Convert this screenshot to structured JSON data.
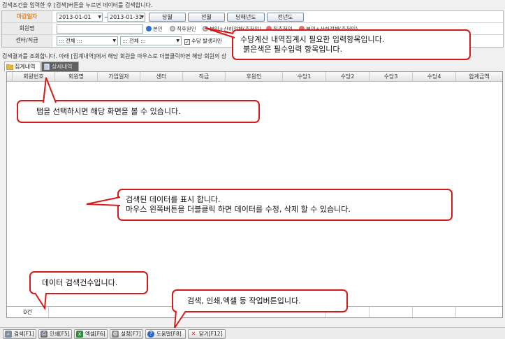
{
  "header": {
    "search_info": "검색조건을 입력한 후 [검색]버튼을 누르면 데이터를 검색합니다."
  },
  "conditions": {
    "closing_month": {
      "label": "마감일자",
      "from": "2013-01-01",
      "to": "2013-01-31",
      "separator": "~",
      "period_buttons": [
        "당월",
        "전월",
        "당해년도",
        "전년도"
      ]
    },
    "member_name": {
      "label": "회원명",
      "value": "",
      "radios": [
        "본인",
        "직후원인",
        "본인+산하전체(추천인)",
        "직추천인",
        "본인+산하전체(추천인)"
      ]
    },
    "center_rank": {
      "label": "센터/직급",
      "center_select": "::: 전체 :::",
      "rank_select": "::: 전체 :::",
      "checkbox_label": "수당 발생자만"
    }
  },
  "result_info": "검색결과를 조회합니다. 아래 [집계내역]에서 해당 회원을 마우스로 더블클릭하면 해당 회원의 상",
  "tabs": [
    "집계내역",
    "상세내역"
  ],
  "grid": {
    "columns": [
      "회원번호",
      "회원명",
      "가입일자",
      "센터",
      "직급",
      "후원인",
      "수당1",
      "수당2",
      "수당3",
      "수당4",
      "합계금액"
    ],
    "rows": [],
    "footer_count": "0건"
  },
  "toolbar": {
    "buttons": [
      {
        "label": "검색[F1]",
        "icon": "search-icon"
      },
      {
        "label": "인쇄[F5]",
        "icon": "printer-icon"
      },
      {
        "label": "엑셀[F6]",
        "icon": "excel-icon"
      },
      {
        "label": "설정[F7]",
        "icon": "gear-icon"
      },
      {
        "label": "도움말[F8]",
        "icon": "help-icon"
      },
      {
        "label": "닫기[F12]",
        "icon": "close-icon"
      }
    ]
  },
  "callouts": {
    "required": [
      "수당계산 내역집계시 필요한 입력항목입니다.",
      "붉은색은 필수입력 항목입니다."
    ],
    "tab_help": "탭을 선택하시면 해당 화면을 볼 수 있습니다.",
    "data_help": [
      "검색된 데이터를 표시 합니다.",
      "마우스 왼쪽버튼을 더블클릭 하면 데이터를 수정, 삭제 할 수 있습니다."
    ],
    "count_help": "데이터 검색건수입니다.",
    "toolbar_help": "검색, 인쇄,엑셀 등 작업버튼입니다."
  },
  "colors": {
    "required_label": "#d9832b",
    "callout_border": "#d61a1a",
    "active_tab": "#616161"
  }
}
